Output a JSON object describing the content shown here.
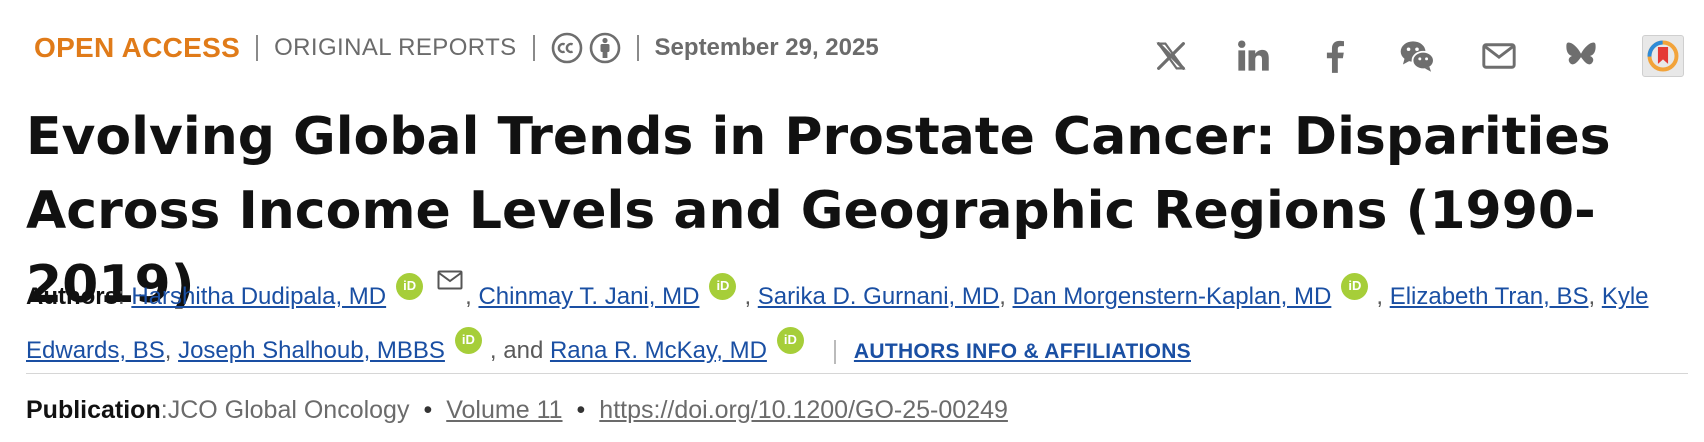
{
  "header": {
    "access_label": "OPEN ACCESS",
    "article_type": "ORIGINAL REPORTS",
    "date": "September 29, 2025",
    "license_icons": [
      "creative-commons-icon",
      "attribution-icon"
    ]
  },
  "share": [
    "x-icon",
    "linkedin-icon",
    "facebook-icon",
    "wechat-icon",
    "email-icon",
    "bluesky-icon",
    "mendeley-icon"
  ],
  "title": "Evolving Global Trends in Prostate Cancer: Disparities Across Income Levels and Geographic Regions (1990-2019)",
  "authors": {
    "label": "Authors",
    "colon": ": ",
    "list": [
      {
        "name": "Harshitha Dudipala, MD",
        "sep": ", "
      },
      {
        "name": "Chinmay T. Jani, MD",
        "sep": ", "
      },
      {
        "name": "Sarika D. Gurnani, MD",
        "sep": ", "
      },
      {
        "name": "Dan Morgenstern-Kaplan, MD",
        "sep": ", "
      },
      {
        "name": "Elizabeth Tran, BS",
        "sep": ", "
      },
      {
        "name": "Kyle Edwards, BS",
        "sep": ", "
      },
      {
        "name": "Joseph Shalhoub, MBBS",
        "sep": ", and "
      },
      {
        "name": "Rana R. McKay, MD",
        "sep": ""
      }
    ],
    "orcid_text": "iD",
    "affiliations_link": "AUTHORS INFO & AFFILIATIONS"
  },
  "publication": {
    "label": "Publication",
    "colon": ": ",
    "journal": "JCO Global Oncology",
    "bullet": "•",
    "volume": "Volume 11",
    "doi": "https://doi.org/10.1200/GO-25-00249"
  },
  "colors": {
    "accent": "#e07b19",
    "link": "#1a4fa3",
    "orcid": "#a6ce39",
    "icon": "#6e6e6e"
  }
}
